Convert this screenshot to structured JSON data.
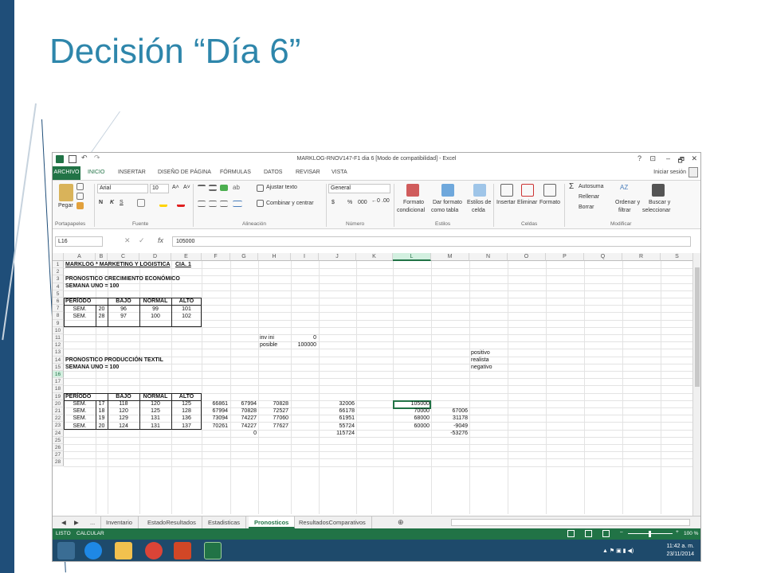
{
  "slide_title": "Decisión “Día 6”",
  "excel": {
    "window_title": "MARKLOG-RNOV147-F1 dia 6 [Modo de compatibilidad] - Excel",
    "window_controls": [
      "?",
      "⊡",
      "–",
      "🗗",
      "✕"
    ],
    "menu": [
      "ARCHIVO",
      "INICIO",
      "INSERTAR",
      "DISEÑO DE PÁGINA",
      "FÓRMULAS",
      "DATOS",
      "REVISAR",
      "VISTA"
    ],
    "signin": "Iniciar sesión",
    "ribbon": {
      "paste": "Pegar",
      "font_name": "Arial",
      "font_size": "10",
      "bold": "N",
      "italic": "K",
      "underline": "S",
      "wrap_text": "Ajustar texto",
      "merge_center": "Combinar y centrar",
      "number_format": "General",
      "currency": "$",
      "percent": "%",
      "thousands": "000",
      "cond_format": [
        "Formato",
        "condicional"
      ],
      "format_table": [
        "Dar formato",
        "como tabla"
      ],
      "cell_styles": [
        "Estilos de",
        "celda"
      ],
      "insert": "Insertar",
      "delete": "Eliminar",
      "format": "Formato",
      "autosum": "Autosuma",
      "fill": "Rellenar",
      "clear": "Borrar",
      "sort_filter": [
        "Ordenar y",
        "filtrar"
      ],
      "find_select": [
        "Buscar y",
        "seleccionar"
      ],
      "groups": [
        "Portapapeles",
        "Fuente",
        "Alineación",
        "Número",
        "Estilos",
        "Celdas",
        "Modificar"
      ]
    },
    "name_box": "L16",
    "fx": "fx",
    "formula_value": "105000",
    "columns": [
      "A",
      "B",
      "C",
      "D",
      "E",
      "F",
      "G",
      "H",
      "I",
      "J",
      "K",
      "L",
      "M",
      "N",
      "O",
      "P",
      "Q",
      "R",
      "S"
    ],
    "rows": [
      "1",
      "2",
      "3",
      "4",
      "5",
      "6",
      "7",
      "8",
      "9",
      "10",
      "11",
      "12",
      "13",
      "14",
      "15",
      "16",
      "17",
      "18",
      "19",
      "20",
      "21",
      "22",
      "23",
      "24",
      "25",
      "26",
      "27",
      "28"
    ],
    "cells": {
      "r1_a": "MARKLOG * MARKETING Y LOGISTICA",
      "r1_e": "CIA.  1",
      "r3": "PRONOSTICO CRECIMIENTO ECONÓMICO",
      "r4": "SEMANA UNO = 100",
      "r5": [
        "PERÍODO",
        "BAJO",
        "NORMAL",
        "ALTO"
      ],
      "r6": [
        "SEM.",
        "20",
        "96",
        "99",
        "101"
      ],
      "r7": [
        "SEM.",
        "28",
        "97",
        "100",
        "102"
      ],
      "r10": [
        "inv ini",
        "0"
      ],
      "r11": [
        "posible",
        "100000"
      ],
      "r12_n": "positivo",
      "r13_a": "PRONOSTICO PRODUCCIÓN TEXTIL",
      "r13_n": "realista",
      "r14_a": "SEMANA UNO = 100",
      "r14_n": "negativo",
      "r15": [
        "PERÍODO",
        "BAJO",
        "NORMAL",
        "ALTO"
      ],
      "r16": [
        "SEM.",
        "17",
        "118",
        "120",
        "125",
        "66861",
        "67994",
        "70828",
        "",
        "32006",
        "",
        "105000",
        ""
      ],
      "r17": [
        "SEM.",
        "18",
        "120",
        "125",
        "128",
        "67994",
        "70828",
        "72527",
        "",
        "66178",
        "",
        "70000",
        "67006"
      ],
      "r18": [
        "SEM.",
        "19",
        "129",
        "131",
        "136",
        "73094",
        "74227",
        "77060",
        "",
        "61951",
        "",
        "68000",
        "31178"
      ],
      "r19": [
        "SEM.",
        "20",
        "124",
        "131",
        "137",
        "70261",
        "74227",
        "77627",
        "",
        "55724",
        "",
        "60000",
        "-9049"
      ],
      "r20": [
        "0",
        "115724",
        "-53276"
      ]
    },
    "sheet_tabs": [
      "...",
      "Inventario",
      "EstadoResultados",
      "Estadisticas",
      "Pronosticos",
      "ResultadosComparativos"
    ],
    "active_tab": "Pronosticos",
    "status_left": [
      "LISTO",
      "CALCULAR"
    ],
    "zoom": "100 %",
    "clock_time": "11:42 a. m.",
    "clock_date": "23/11/2014",
    "colors": {
      "excel_green": "#217346",
      "title_blue": "#2e86ab",
      "bar_navy": "#1f4e79"
    }
  }
}
